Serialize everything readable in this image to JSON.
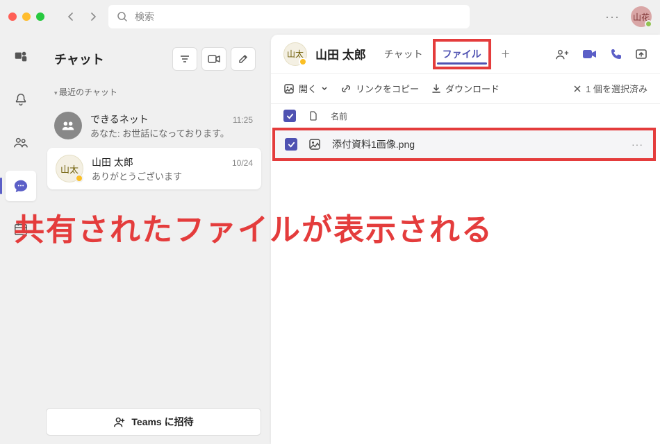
{
  "search": {
    "placeholder": "検索"
  },
  "user": {
    "initials": "山花"
  },
  "sidebar": {
    "title": "チャット",
    "section_label": "最近のチャット",
    "items": [
      {
        "name": "できるネット",
        "preview": "あなた: お世話になっております。",
        "time": "11:25"
      },
      {
        "avatar": "山太",
        "name": "山田 太郎",
        "preview": "ありがとうございます",
        "time": "10/24"
      }
    ],
    "invite_label": "Teams に招待"
  },
  "main": {
    "avatar": "山太",
    "title": "山田 太郎",
    "tabs": {
      "chat": "チャット",
      "file": "ファイル"
    },
    "toolbar": {
      "open": "開く",
      "link": "リンクをコピー",
      "download": "ダウンロード",
      "selected": "1 個を選択済み"
    },
    "file_head": {
      "name_col": "名前"
    },
    "file_row": {
      "name": "添付資料1画像.png"
    }
  },
  "annotation": "共有されたファイルが表示される"
}
